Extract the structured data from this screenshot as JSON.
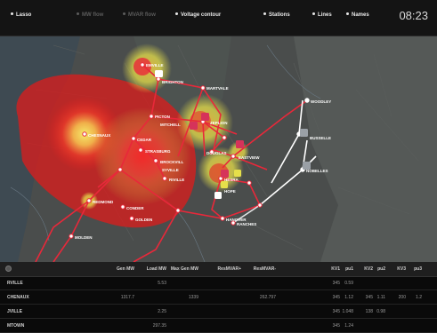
{
  "toolbar": {
    "lasso": "Lasso",
    "mw_flow": "MW flow",
    "mvar_flow": "MVAR flow",
    "voltage_contour": "Voltage contour",
    "stations": "Stations",
    "lines": "Lines",
    "names": "Names",
    "clock": "08:23"
  },
  "stations": {
    "s1": "EMVILLE",
    "s2": "BRIGHTON",
    "s3": "MARTVALE",
    "s4": "PICTON",
    "s5": "MITCHELL",
    "s6": "ZEPLION",
    "s7": "CHESNAUX",
    "s8": "CEDAR",
    "s9": "STRASBURG",
    "s10": "BROCKVILL",
    "s11": "RIVILLE",
    "s12": "SYVILLE",
    "s13": "DOUGLAS",
    "s14": "EASTVIEW",
    "s15": "WOODLEY",
    "s16": "BUSSELLE",
    "s17": "NOBELLES",
    "s18": "HESRA",
    "s19": "HOPE",
    "s20": "REDMOND",
    "s21": "CONDER",
    "s22": "GOLDEN",
    "s23": "HANOVER",
    "s24": "RANCHES",
    "s25": "MOLDEN"
  },
  "table": {
    "columns": [
      "Gen MW",
      "Load MW",
      "Max Gen MW",
      "ResMVAR+",
      "ResMVAR-",
      "KV1",
      "pu1",
      "KV2",
      "pu2",
      "KV3",
      "pu3"
    ],
    "rows": [
      {
        "name": "RVILLE",
        "cells": [
          "",
          "5.53",
          "",
          "",
          "",
          "345",
          "0.59",
          "",
          "",
          "",
          ""
        ]
      },
      {
        "name": "CHENAUX",
        "cells": [
          "1317.7",
          "",
          "1339",
          "",
          "262.797",
          "345",
          "1.12",
          "345",
          "1.11",
          "200",
          "1.2"
        ]
      },
      {
        "name": "JVILLE",
        "cells": [
          "",
          "2.25",
          "",
          "",
          "",
          "345",
          "1.048",
          "138",
          "0.98",
          "",
          ""
        ]
      },
      {
        "name": "MTOWN",
        "cells": [
          "",
          "297.35",
          "",
          "",
          "",
          "345",
          "1.24",
          "",
          "",
          "",
          ""
        ]
      }
    ]
  },
  "colors": {
    "contour_red": "#e02020",
    "contour_yellow": "#e6e04a",
    "line_red": "#e8283a",
    "line_white": "#ffffff",
    "marker_pink": "#d6335a",
    "marker_gray": "#9aa0a6"
  },
  "icons": {
    "settings": "gear-icon"
  }
}
